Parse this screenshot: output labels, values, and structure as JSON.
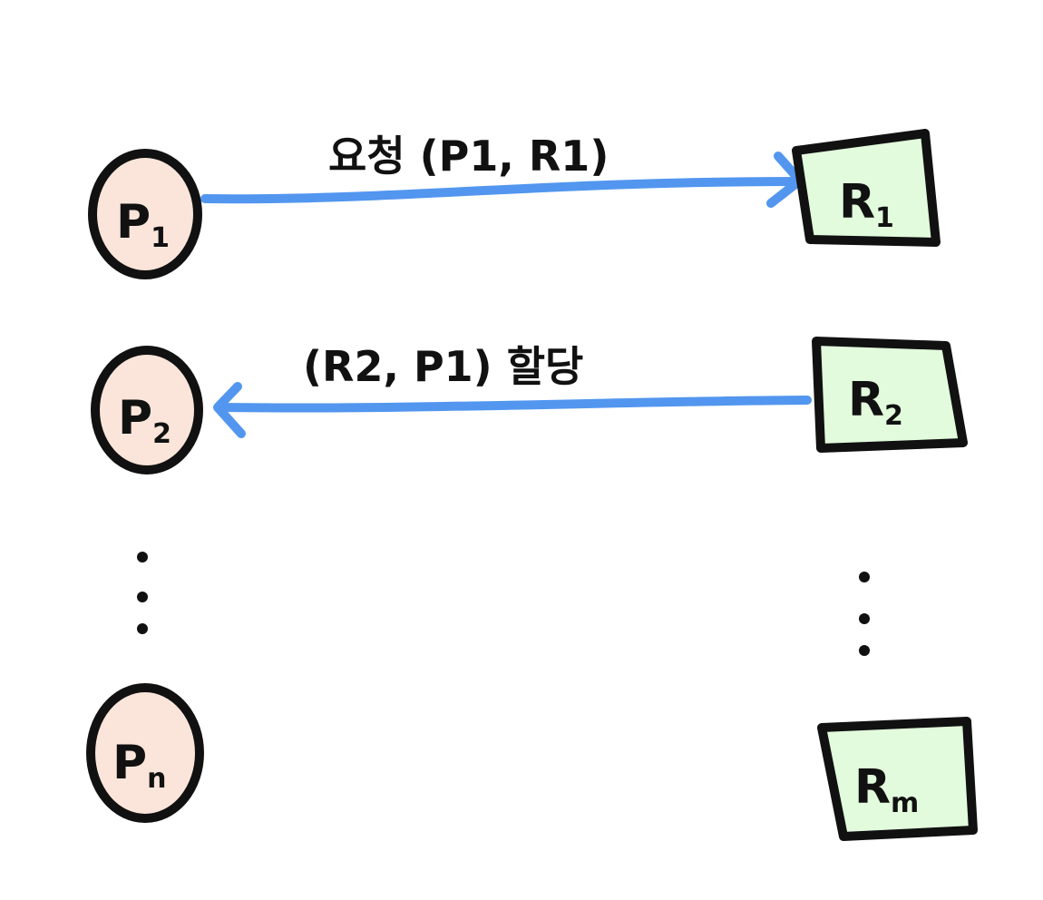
{
  "colors": {
    "process_fill": "#fbe5da",
    "resource_fill": "#e2fbdc",
    "stroke": "#111111",
    "arrow": "#5296ef"
  },
  "processes": [
    {
      "main": "P",
      "sub": "1"
    },
    {
      "main": "P",
      "sub": "2"
    },
    {
      "main": "P",
      "sub": "n"
    }
  ],
  "resources": [
    {
      "main": "R",
      "sub": "1"
    },
    {
      "main": "R",
      "sub": "2"
    },
    {
      "main": "R",
      "sub": "m"
    }
  ],
  "edges": [
    {
      "label": "요청 (P1, R1)",
      "direction": "process-to-resource"
    },
    {
      "label": "(R2, P1) 할당",
      "direction": "resource-to-process"
    }
  ]
}
